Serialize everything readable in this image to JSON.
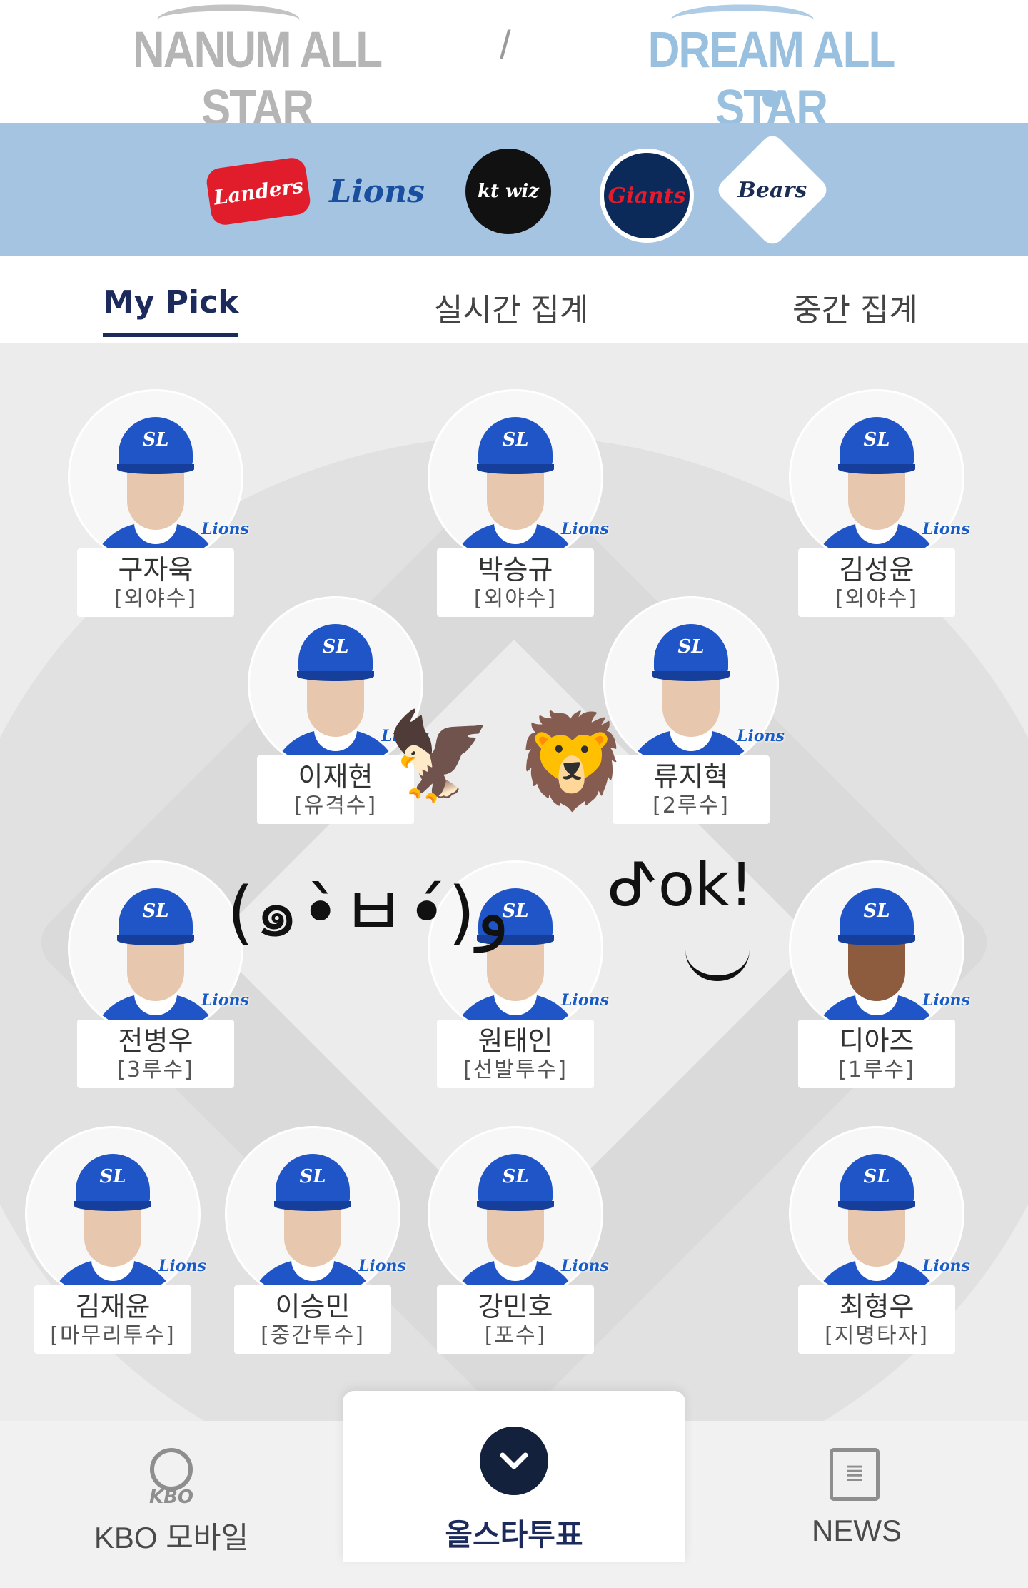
{
  "header": {
    "left_brand": "NANUM ALL STAR",
    "separator": "/",
    "right_brand": "DREAM ALL STAR"
  },
  "teams": [
    {
      "name": "SSG Landers",
      "logo_text": "Landers"
    },
    {
      "name": "Samsung Lions",
      "logo_text": "Lions"
    },
    {
      "name": "kt wiz",
      "logo_text": "kt wiz"
    },
    {
      "name": "Lotte Giants",
      "logo_text": "Giants"
    },
    {
      "name": "Doosan Bears",
      "logo_text": "Bears"
    }
  ],
  "tabs": [
    {
      "label": "My Pick",
      "active": true
    },
    {
      "label": "실시간 집계",
      "active": false
    },
    {
      "label": "중간 집계",
      "active": false
    }
  ],
  "players": [
    {
      "name": "구자욱",
      "position": "[외야수]",
      "cap": "SL"
    },
    {
      "name": "박승규",
      "position": "[외야수]",
      "cap": "SL"
    },
    {
      "name": "김성윤",
      "position": "[외야수]",
      "cap": "SL"
    },
    {
      "name": "이재현",
      "position": "[유격수]",
      "cap": "SL"
    },
    {
      "name": "류지혁",
      "position": "[2루수]",
      "cap": "SL"
    },
    {
      "name": "전병우",
      "position": "[3루수]",
      "cap": "SL"
    },
    {
      "name": "원태인",
      "position": "[선발투수]",
      "cap": "SL"
    },
    {
      "name": "디아즈",
      "position": "[1루수]",
      "cap": "SL"
    },
    {
      "name": "김재윤",
      "position": "[마무리투수]",
      "cap": "SL"
    },
    {
      "name": "이승민",
      "position": "[중간투수]",
      "cap": "SL"
    },
    {
      "name": "강민호",
      "position": "[포수]",
      "cap": "SL"
    },
    {
      "name": "최형우",
      "position": "[지명타자]",
      "cap": "SL"
    }
  ],
  "badge_text": "Lions",
  "stickers": {
    "eagle": "🦅",
    "lion": "🦁",
    "kaomoji": "(๑•̀ㅂ•́)و",
    "ok": "ᕷᴏk!"
  },
  "bottom_nav": {
    "kbo_logo_text": "KBO",
    "kbo_label": "KBO 모바일",
    "vote_icon": "chevron-down-icon",
    "vote_label": "올스타투표",
    "news_label": "NEWS"
  },
  "colors": {
    "team_bar": "#a5c4e1",
    "active_tab": "#1c2b5c",
    "cap_blue": "#1f55c6"
  }
}
